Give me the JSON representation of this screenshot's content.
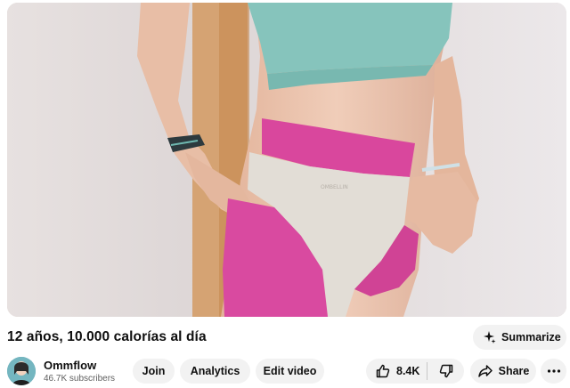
{
  "video": {
    "title": "12 años, 10.000 calorías al día",
    "thumbnail_description_icon": "video-frame"
  },
  "actions": {
    "summarize_label": "Summarize",
    "summarize_icon": "sparkle-icon"
  },
  "channel": {
    "name": "Ommflow",
    "subscribers": "46.7K subscribers",
    "avatar_icon": "avatar"
  },
  "buttons": {
    "join": "Join",
    "analytics": "Analytics",
    "edit_video": "Edit video",
    "likes": "8.4K",
    "share": "Share",
    "more_icon": "more-horizontal-icon"
  },
  "colors": {
    "button_bg": "#f2f2f2",
    "text": "#0f0f0f",
    "secondary_text": "#606060"
  }
}
